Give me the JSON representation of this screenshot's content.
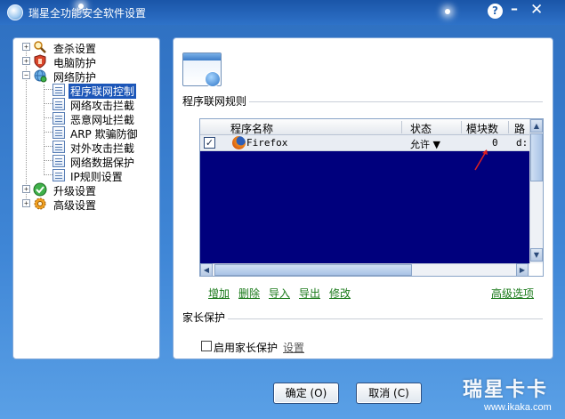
{
  "window": {
    "title": "瑞星全功能安全软件设置",
    "help_label": "?",
    "minimize_label": "–",
    "close_label": "✕"
  },
  "tree": {
    "items": [
      {
        "label": "查杀设置",
        "icon": "magnifier-icon"
      },
      {
        "label": "电脑防护",
        "icon": "shield-hand-icon"
      },
      {
        "label": "网络防护",
        "icon": "globe-network-icon"
      },
      {
        "label": "程序联网控制",
        "icon": "document-icon",
        "selected": true
      },
      {
        "label": "网络攻击拦截",
        "icon": "document-icon"
      },
      {
        "label": "恶意网址拦截",
        "icon": "document-icon"
      },
      {
        "label": "ARP 欺骗防御",
        "icon": "document-icon"
      },
      {
        "label": "对外攻击拦截",
        "icon": "document-icon"
      },
      {
        "label": "网络数据保护",
        "icon": "document-icon"
      },
      {
        "label": "IP规则设置",
        "icon": "document-icon"
      },
      {
        "label": "升级设置",
        "icon": "green-check-icon"
      },
      {
        "label": "高级设置",
        "icon": "gear-icon"
      }
    ],
    "expanders": {
      "collapsed": "+",
      "expanded": "−"
    }
  },
  "main": {
    "section_title": "程序联网规则",
    "table": {
      "columns": [
        "程序名称",
        "状态",
        "模块数",
        "路"
      ],
      "rows": [
        {
          "checked": true,
          "check_mark": "✓",
          "name": "Firefox",
          "status": "允许 ▼",
          "modules": "0",
          "path": "d:"
        }
      ]
    },
    "actions": [
      "增加",
      "删除",
      "导入",
      "导出",
      "修改"
    ],
    "advanced_link": "高级选项",
    "parent_section_title": "家长保护",
    "parent_checkbox_label": "启用家长保护",
    "parent_settings_link": "设置"
  },
  "footer": {
    "ok_label": "确定 (O)",
    "cancel_label": "取消 (C)"
  },
  "watermark": {
    "title": "瑞星卡卡",
    "url": "www.ikaka.com"
  },
  "colors": {
    "title_bar": "#1a55a8",
    "selection": "#1c56b8",
    "table_body": "#00007d",
    "link_green": "#1a7a1a",
    "annotation_arrow": "#e02020"
  }
}
